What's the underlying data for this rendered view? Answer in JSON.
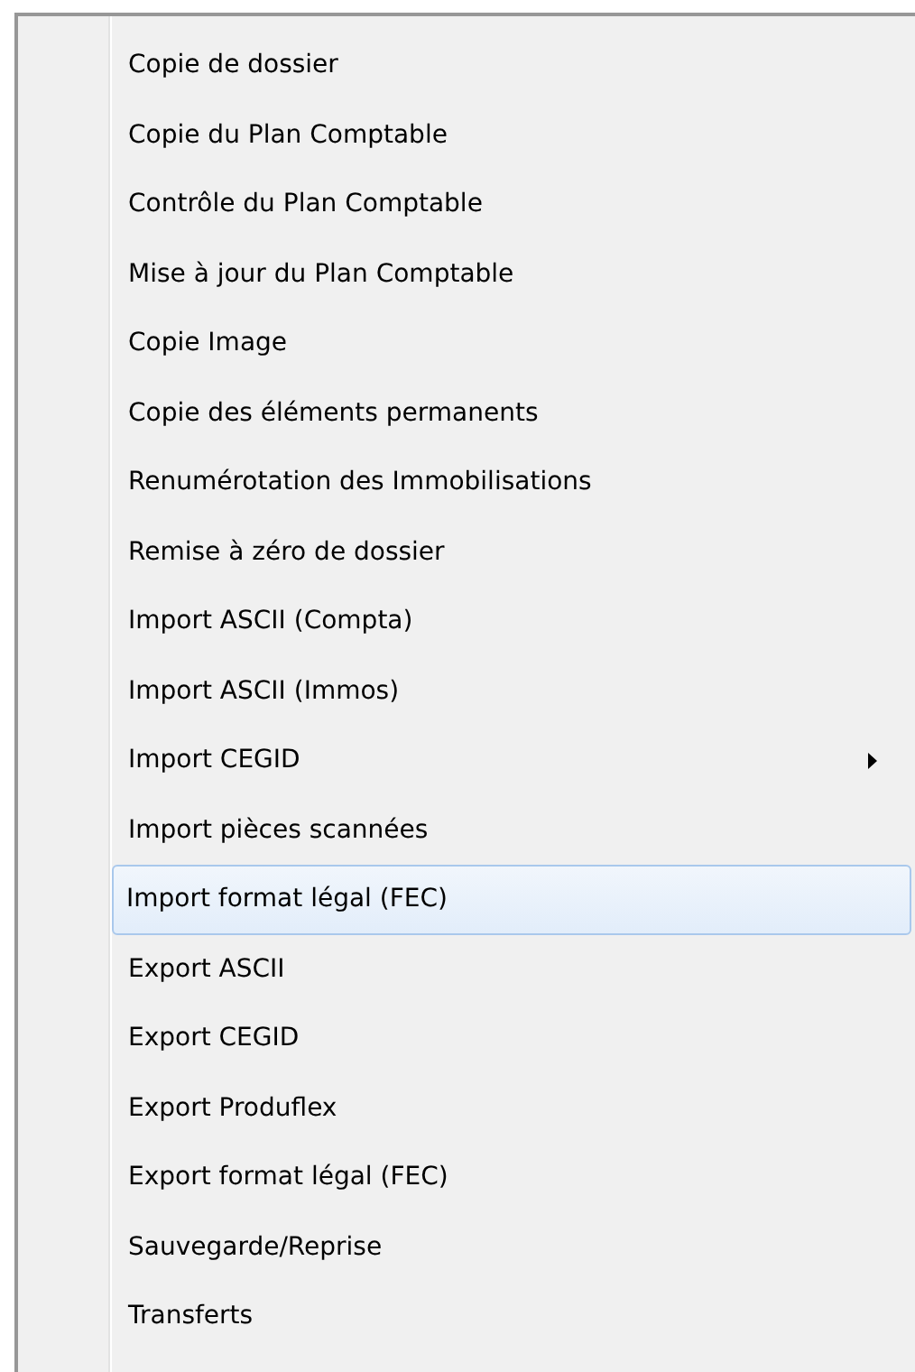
{
  "menu": {
    "items": [
      {
        "label": "Copie de dossier",
        "selected": false,
        "has_submenu": false
      },
      {
        "label": "Copie du Plan Comptable",
        "selected": false,
        "has_submenu": false
      },
      {
        "label": "Contrôle du Plan Comptable",
        "selected": false,
        "has_submenu": false
      },
      {
        "label": "Mise à jour du Plan Comptable",
        "selected": false,
        "has_submenu": false
      },
      {
        "label": "Copie Image",
        "selected": false,
        "has_submenu": false
      },
      {
        "label": "Copie des éléments permanents",
        "selected": false,
        "has_submenu": false
      },
      {
        "label": "Renumérotation des Immobilisations",
        "selected": false,
        "has_submenu": false
      },
      {
        "label": "Remise à zéro de dossier",
        "selected": false,
        "has_submenu": false
      },
      {
        "label": "Import ASCII (Compta)",
        "selected": false,
        "has_submenu": false
      },
      {
        "label": "Import ASCII (Immos)",
        "selected": false,
        "has_submenu": false
      },
      {
        "label": "Import CEGID",
        "selected": false,
        "has_submenu": true
      },
      {
        "label": "Import pièces scannées",
        "selected": false,
        "has_submenu": false
      },
      {
        "label": "Import format légal (FEC)",
        "selected": true,
        "has_submenu": false
      },
      {
        "label": "Export ASCII",
        "selected": false,
        "has_submenu": false
      },
      {
        "label": "Export CEGID",
        "selected": false,
        "has_submenu": false
      },
      {
        "label": "Export Produflex",
        "selected": false,
        "has_submenu": false
      },
      {
        "label": "Export format légal (FEC)",
        "selected": false,
        "has_submenu": false
      },
      {
        "label": "Sauvegarde/Reprise",
        "selected": false,
        "has_submenu": false
      },
      {
        "label": "Transferts",
        "selected": false,
        "has_submenu": false
      }
    ]
  }
}
